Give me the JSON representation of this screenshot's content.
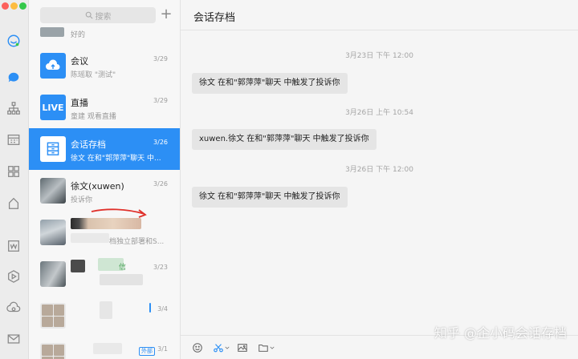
{
  "search": {
    "placeholder": "搜索"
  },
  "top_snippet": {
    "preview": "好的"
  },
  "conversations": [
    {
      "name": "会议",
      "date": "3/29",
      "preview": "陈瑶取            \"测试\"",
      "avatar": "cloud-icon"
    },
    {
      "name": "直播",
      "date": "3/29",
      "preview": "童建          观看直播",
      "avatar": "live-icon",
      "avatar_text": "LIVE"
    },
    {
      "name": "会话存档",
      "date": "3/26",
      "preview": "徐文 在和\"郭萍萍\"聊天 中...",
      "avatar": "archive-icon",
      "active": true
    },
    {
      "name": "徐文(xuwen)",
      "date": "3/26",
      "preview": "投诉你",
      "avatar": "photo"
    },
    {
      "name": "",
      "date": "",
      "preview": "档独立部署和S...",
      "avatar": "photo"
    },
    {
      "name": "信",
      "date": "3/23",
      "preview": "",
      "avatar": "photo"
    },
    {
      "name": "",
      "date": "3/4",
      "preview": "",
      "avatar": "group"
    },
    {
      "name": "",
      "date": "3/1",
      "preview": "",
      "avatar": "group",
      "badge": "外部"
    }
  ],
  "chat": {
    "title": "会话存档",
    "messages": [
      {
        "time": "3月23日 下午 12:00",
        "text": "徐文 在和\"郭萍萍\"聊天 中触发了投诉你"
      },
      {
        "time": "3月26日 上午 10:54",
        "text": "xuwen.徐文 在和\"郭萍萍\"聊天 中触发了投诉你"
      },
      {
        "time": "3月26日 下午 12:00",
        "text": "徐文 在和\"郭萍萍\"聊天 中触发了投诉你"
      }
    ]
  },
  "watermark": "知乎 @企小码会话存档",
  "colors": {
    "accent": "#2c8ff5",
    "rail_bg": "#ececec",
    "list_bg": "#f7f7f7",
    "bubble_bg": "#e5e5e5",
    "annotation": "#e0302a"
  }
}
